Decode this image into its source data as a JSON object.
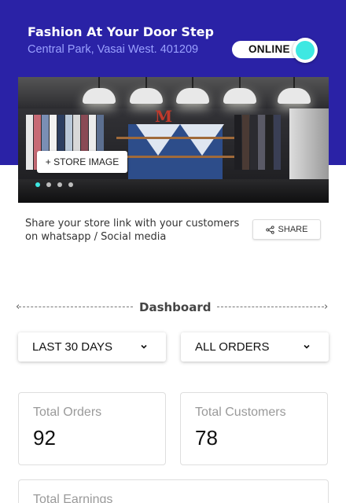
{
  "store": {
    "title": "Fashion At Your Door Step",
    "address": "Central Park, Vasai West. 401209",
    "status_label": "ONLINE",
    "status_on": true
  },
  "banner": {
    "add_image_label": "+ STORE IMAGE",
    "slide_count": 4,
    "active_slide": 1
  },
  "share": {
    "text": "Share your store link with your customers on whatsapp / Social media",
    "button_label": "SHARE"
  },
  "dashboard": {
    "title": "Dashboard",
    "period_filter": "LAST 30 DAYS",
    "orders_filter": "ALL ORDERS",
    "stats": [
      {
        "label": "Total Orders",
        "value": "92"
      },
      {
        "label": "Total Customers",
        "value": "78"
      },
      {
        "label": "Total Earnings",
        "value": ""
      }
    ]
  },
  "colors": {
    "header_bg": "#2a22a6",
    "address_text": "#9aa0ff",
    "toggle_accent": "#3ee8e2"
  },
  "icons": {
    "share": "share-icon",
    "dropdown": "chevron-down-icon"
  }
}
